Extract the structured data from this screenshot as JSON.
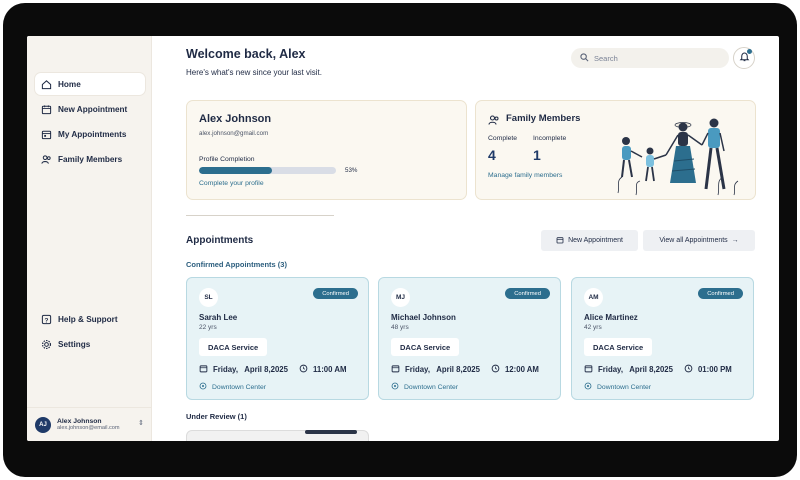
{
  "sidebar": {
    "items": [
      {
        "label": "Home",
        "icon": "home-icon",
        "active": true
      },
      {
        "label": "New Appointment",
        "icon": "calendar-plus-icon"
      },
      {
        "label": "My Appointments",
        "icon": "calendar-icon"
      },
      {
        "label": "Family Members",
        "icon": "users-icon"
      }
    ],
    "bottom_items": [
      {
        "label": "Help & Support",
        "icon": "help-icon"
      },
      {
        "label": "Settings",
        "icon": "gear-icon"
      }
    ],
    "user": {
      "initials": "AJ",
      "name": "Alex Johnson",
      "email": "alex.johnson@email.com"
    }
  },
  "header": {
    "welcome": "Welcome back, Alex",
    "subtitle": "Here's what's new since your last visit.",
    "search_placeholder": "Search"
  },
  "profile": {
    "name": "Alex Johnson",
    "email": "alex.johnson@gmail.com",
    "completion_label": "Profile Completion",
    "completion_percent": 53,
    "completion_text": "53%",
    "link": "Complete your profile"
  },
  "family": {
    "title": "Family Members",
    "complete_label": "Complete",
    "complete_value": "4",
    "incomplete_label": "Incomplete",
    "incomplete_value": "1",
    "link": "Manage family members"
  },
  "appointments": {
    "title": "Appointments",
    "new_button": "New Appointment",
    "view_all_button": "View all Appointments",
    "confirmed_heading": "Confirmed Appointments (3)",
    "items": [
      {
        "initials": "SL",
        "name": "Sarah Lee",
        "age": "22 yrs",
        "status": "Confirmed",
        "service": "DACA Service",
        "date": "Friday,   April 8,2025",
        "time": "11:00 AM",
        "location": "Downtown Center"
      },
      {
        "initials": "MJ",
        "name": "Michael Johnson",
        "age": "48 yrs",
        "status": "Confirmed",
        "service": "DACA Service",
        "date": "Friday,   April 8,2025",
        "time": "12:00 AM",
        "location": "Downtown Center"
      },
      {
        "initials": "AM",
        "name": "Alice Martinez",
        "age": "42 yrs",
        "status": "Confirmed",
        "service": "DACA Service",
        "date": "Friday,   April 8,2025",
        "time": "01:00 PM",
        "location": "Downtown Center"
      }
    ],
    "review_heading": "Under Review (1)"
  },
  "colors": {
    "accent": "#2c6e8e",
    "navy": "#1f3a68",
    "card_bg": "#fbf8f1",
    "appt_bg": "#e7f3f6"
  }
}
